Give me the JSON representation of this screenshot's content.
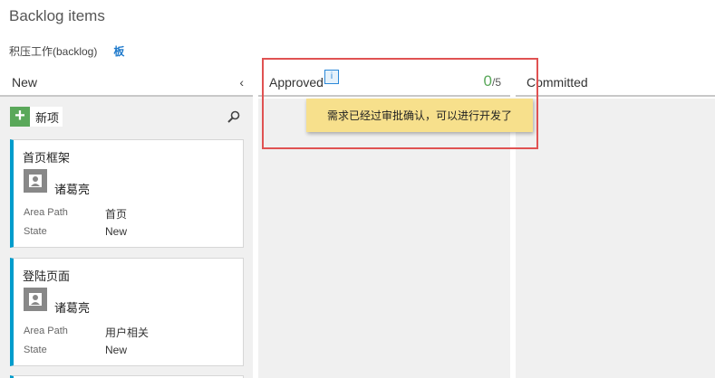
{
  "header": {
    "title": "Backlog items",
    "tabs": [
      {
        "label": "积压工作(backlog)"
      },
      {
        "label": "板"
      }
    ]
  },
  "columns": {
    "new": {
      "title": "New",
      "collapse_glyph": "‹",
      "new_item_label": "新项"
    },
    "approved": {
      "title": "Approved",
      "info_glyph": "i",
      "wip_current": "0",
      "wip_limit": "/5",
      "tooltip": "需求已经过审批确认，可以进行开发了"
    },
    "committed": {
      "title": "Committed"
    }
  },
  "cards": [
    {
      "title": "首页框架",
      "assignee": "诸葛亮",
      "area_path_label": "Area Path",
      "area_path": "首页",
      "state_label": "State",
      "state": "New"
    },
    {
      "title": "登陆页面",
      "assignee": "诸葛亮",
      "area_path_label": "Area Path",
      "area_path": "用户相关",
      "state_label": "State",
      "state": "New"
    }
  ],
  "icons": {
    "new_item": "plus-icon",
    "search": "search-icon",
    "collapse": "chevron-left-icon",
    "info": "info-icon",
    "avatar": "person-icon"
  },
  "colors": {
    "card_accent": "#009ccc",
    "add_green": "#5aa85a",
    "board_tab": "#1f7acc",
    "highlight": "#e05252",
    "tooltip_bg": "#f7e08c"
  }
}
